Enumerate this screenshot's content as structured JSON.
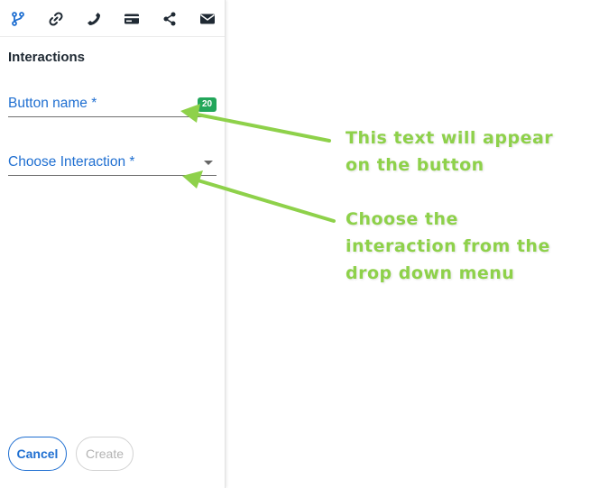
{
  "toolbar": {
    "icons": [
      "branch-icon",
      "link-icon",
      "phone-icon",
      "card-icon",
      "share-icon",
      "mail-icon"
    ],
    "icon_color": "#1f2933",
    "active_color": "#1f6fd1"
  },
  "panel": {
    "title": "Interactions",
    "fields": {
      "button_name": {
        "label": "Button name *",
        "counter": "20"
      },
      "interaction": {
        "label": "Choose Interaction *"
      }
    },
    "actions": {
      "cancel_label": "Cancel",
      "create_label": "Create"
    }
  },
  "annotations": {
    "color": "#8ed14a",
    "button_text_note": {
      "line1": "This text will appear",
      "line2": "on the button"
    },
    "interaction_note": {
      "line1": "Choose the",
      "line2": "interaction from the",
      "line3": "drop down menu"
    }
  },
  "colors": {
    "accent": "#1f6fd1",
    "counter_badge": "#22a65a",
    "annotation": "#8ed14a"
  }
}
